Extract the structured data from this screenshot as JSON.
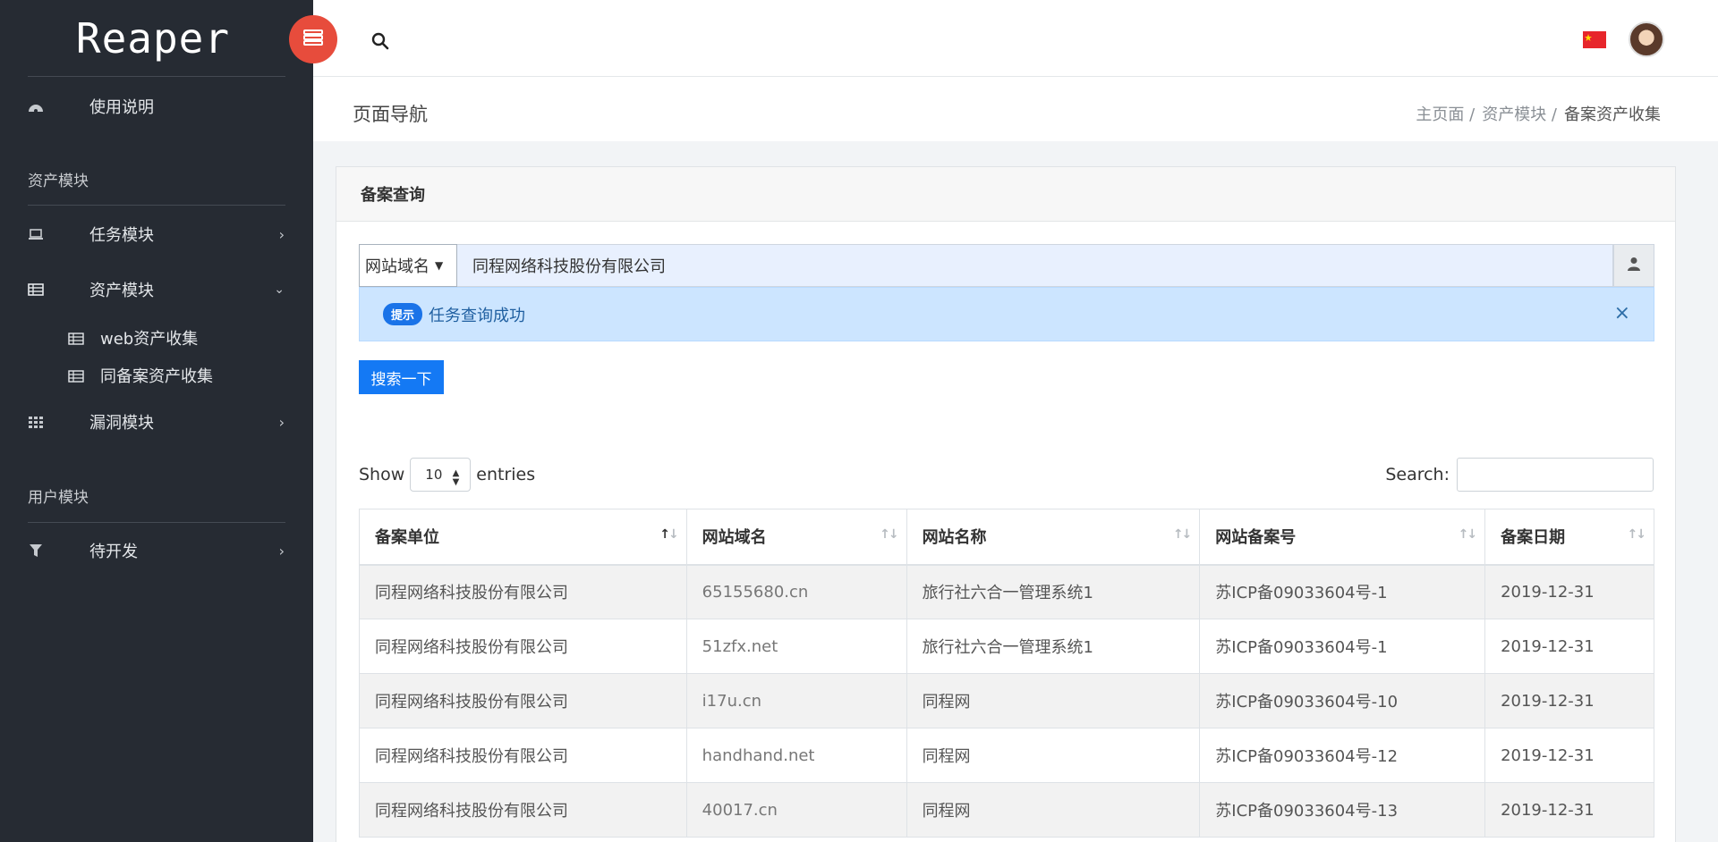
{
  "app": {
    "brand": "Reaper"
  },
  "sidebar": {
    "usage": "使用说明",
    "section_assets": "资产模块",
    "task_module": "任务模块",
    "asset_module": "资产模块",
    "sub_web": "web资产收集",
    "sub_icp": "同备案资产收集",
    "vuln_module": "漏洞模块",
    "section_users": "用户模块",
    "todo": "待开发"
  },
  "header": {
    "page_title": "页面导航",
    "breadcrumb": [
      "主页面 /",
      "资产模块 /",
      "备案资产收集"
    ]
  },
  "card": {
    "title": "备案查询",
    "select_value": "网站域名",
    "query_value": "同程网络科技股份有限公司",
    "alert_badge": "提示",
    "alert_text": "任务查询成功",
    "alert_close": "×",
    "search_button": "搜索一下"
  },
  "table_controls": {
    "show": "Show",
    "length_value": "10",
    "entries": "entries",
    "search_label": "Search:"
  },
  "table": {
    "columns": [
      "备案单位",
      "网站域名",
      "网站名称",
      "网站备案号",
      "备案日期"
    ],
    "rows": [
      [
        "同程网络科技股份有限公司",
        "65155680.cn",
        "旅行社六合一管理系统1",
        "苏ICP备09033604号-1",
        "2019-12-31"
      ],
      [
        "同程网络科技股份有限公司",
        "51zfx.net",
        "旅行社六合一管理系统1",
        "苏ICP备09033604号-1",
        "2019-12-31"
      ],
      [
        "同程网络科技股份有限公司",
        "i17u.cn",
        "同程网",
        "苏ICP备09033604号-10",
        "2019-12-31"
      ],
      [
        "同程网络科技股份有限公司",
        "handhand.net",
        "同程网",
        "苏ICP备09033604号-12",
        "2019-12-31"
      ],
      [
        "同程网络科技股份有限公司",
        "40017.cn",
        "同程网",
        "苏ICP备09033604号-13",
        "2019-12-31"
      ]
    ]
  },
  "colors": {
    "sidebar": "#262b33",
    "accent": "#1479f4",
    "toggle": "#e74c3c",
    "alert_bg": "#cce5ff"
  }
}
